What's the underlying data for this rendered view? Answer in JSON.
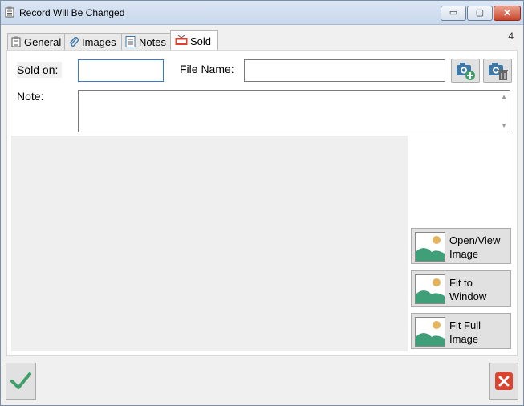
{
  "window": {
    "title": "Record Will Be Changed",
    "title_icon": "clipboard-icon",
    "minimize_glyph": "▭",
    "maximize_glyph": "▢",
    "close_glyph": "✕"
  },
  "counter": "4",
  "tabs": [
    {
      "label": "General",
      "icon": "clipboard-icon",
      "active": false
    },
    {
      "label": "Images",
      "icon": "paperclip-icon",
      "active": false
    },
    {
      "label": "Notes",
      "icon": "notes-icon",
      "active": false
    },
    {
      "label": "Sold",
      "icon": "sold-sign-icon",
      "active": true
    }
  ],
  "form": {
    "sold_on_label": "Sold on:",
    "sold_on_value": "",
    "file_name_label": "File Name:",
    "file_name_value": "",
    "note_label": "Note:",
    "note_value": ""
  },
  "image_buttons": [
    {
      "line1": "Open/View",
      "line2": "Image"
    },
    {
      "line1": "Fit to",
      "line2": "Window"
    },
    {
      "line1": "Fit Full",
      "line2": "Image"
    }
  ],
  "colors": {
    "ok_check": "#3f9f6a",
    "cancel_red": "#d9432f",
    "landscape_green": "#3f9f79",
    "sun_orange": "#e5b25d",
    "camera_blue": "#3e78a8"
  }
}
